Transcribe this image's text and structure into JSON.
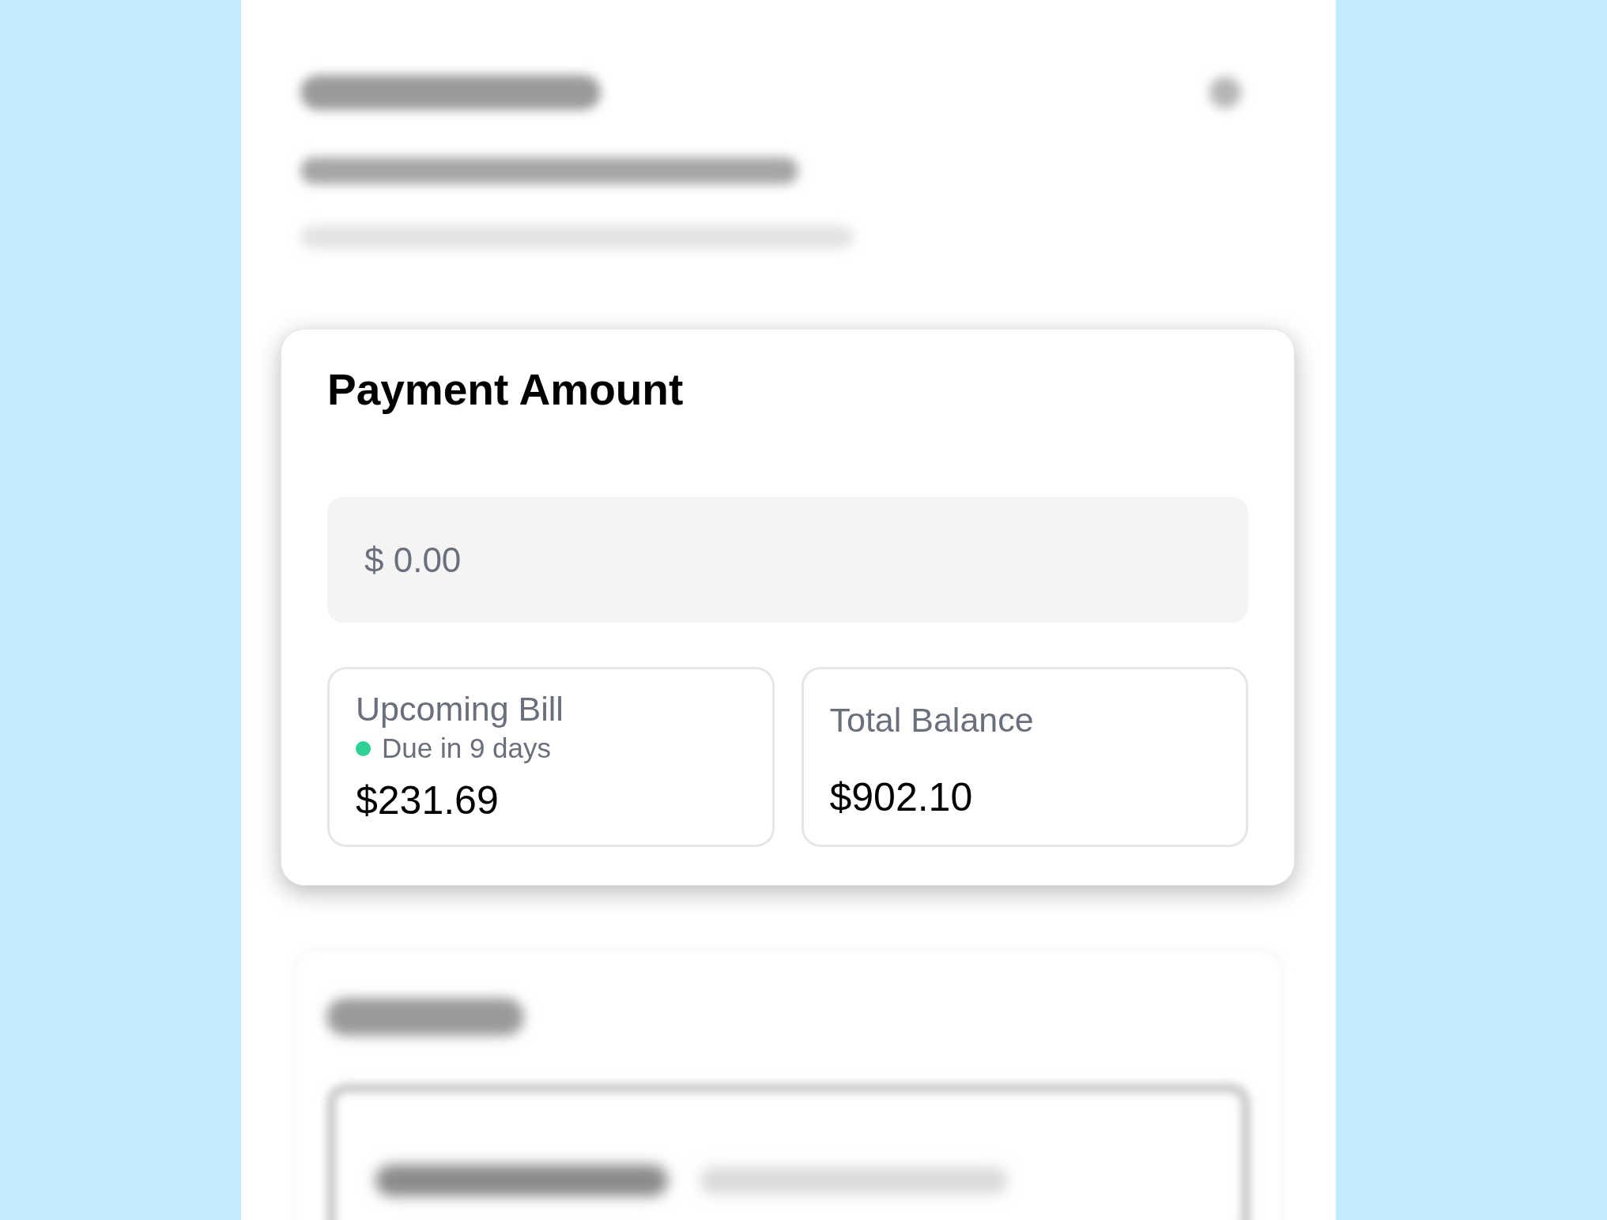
{
  "payment_card": {
    "title": "Payment Amount",
    "amount_field": {
      "placeholder": "$ 0.00"
    },
    "upcoming_bill": {
      "label": "Upcoming Bill",
      "status": "Due in 9 days",
      "color": "#2fd095",
      "amount": "$231.69"
    },
    "total_balance": {
      "label": "Total Balance",
      "amount": "$902.10"
    }
  }
}
